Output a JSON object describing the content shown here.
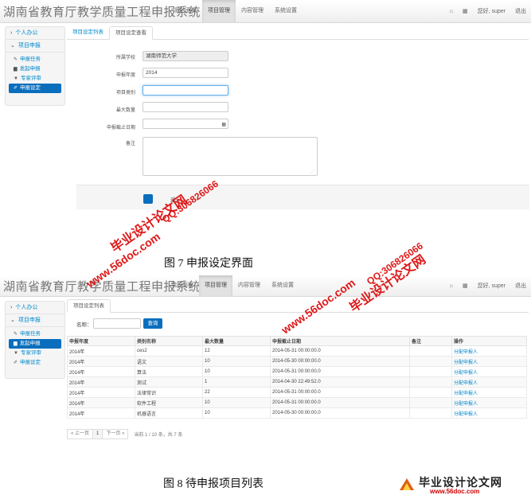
{
  "app": {
    "title": "湖南省教育厅教学质量工程申报系统",
    "nav": [
      "我的面板",
      "项目管理",
      "内容管理",
      "系统设置"
    ],
    "active_nav": 1,
    "greeting": "您好, super",
    "logout": "退出",
    "home_icon": "home-icon",
    "grid_icon": "apps-icon"
  },
  "sidebar": {
    "personal": "个人办公",
    "project": "项目申报",
    "items": [
      {
        "label": "申报任务",
        "icon": "pencil-icon"
      },
      {
        "label": "发起申报",
        "icon": "file-icon"
      },
      {
        "label": "专家评审",
        "icon": "filter-icon"
      },
      {
        "label": "申报设定",
        "icon": "wrench-icon"
      }
    ]
  },
  "screen1": {
    "tabs": [
      "项目设定列表",
      "项目设定查看"
    ],
    "form": {
      "school_label": "所属学校",
      "school_value": "湖南师范大学",
      "year_label": "申报年度",
      "year_value": "2014",
      "category_label": "项目类别",
      "category_value": "",
      "max_label": "最大数量",
      "max_value": "",
      "deadline_label": "申报截止日期",
      "deadline_value": "",
      "note_label": "备注"
    },
    "back_label": "返..."
  },
  "screen2": {
    "tabs": [
      "项目设定列表"
    ],
    "search_label": "名称：",
    "search_button": "查询",
    "table": {
      "headers": [
        "申报年度",
        "类别名称",
        "最大数量",
        "申报截止日期",
        "备注",
        "操作"
      ],
      "rows": [
        [
          "2014年",
          "ces2",
          "12",
          "2014-05-31 00:00:00.0",
          "",
          "分配申报人"
        ],
        [
          "2014年",
          "语文",
          "10",
          "2014-05-30 00:00:00.0",
          "",
          "分配申报人"
        ],
        [
          "2014年",
          "算法",
          "10",
          "2014-05-31 00:00:00.0",
          "",
          "分配申报人"
        ],
        [
          "2014年",
          "测试",
          "1",
          "2014-04-30 22:49:52.0",
          "",
          "分配申报人"
        ],
        [
          "2014年",
          "法律常识",
          "22",
          "2014-05-31 00:00:00.0",
          "",
          "分配申报人"
        ],
        [
          "2014年",
          "软件工程",
          "10",
          "2014-05-31 00:00:00.0",
          "",
          "分配申报人"
        ],
        [
          "2014年",
          "机器语言",
          "10",
          "2014-05-30 00:00:00.0",
          "",
          "分配申报人"
        ]
      ]
    },
    "pager": {
      "prev": "« 上一页",
      "current": "1",
      "next": "下一页 »",
      "info": "当前  1  / 10  条，共 7 条"
    }
  },
  "captions": {
    "fig7": "图 7 申报设定界面",
    "fig8": "图 8  待申报项目列表"
  },
  "watermarks": {
    "site_name": "毕业设计论文网",
    "url": "www.56doc.com",
    "qq": "QQ:306826066"
  },
  "logo": {
    "name": "毕业设计论文网",
    "url": "www.56doc.com"
  },
  "colors": {
    "accent": "#0a6ebd",
    "link": "#0088cc",
    "watermark": "#dc0000"
  }
}
